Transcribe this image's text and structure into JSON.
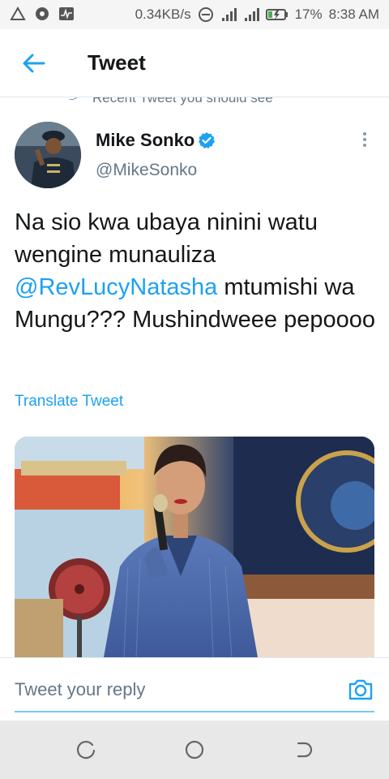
{
  "status_bar": {
    "net_speed": "0.34KB/s",
    "battery": "17%",
    "time": "8:38 AM",
    "icons": [
      "alert-triangle-icon",
      "chrome-icon",
      "pulse-icon",
      "dnd-icon",
      "signal-icon",
      "signal-icon",
      "battery-charging-icon"
    ]
  },
  "app_bar": {
    "title": "Tweet",
    "back_icon": "arrow-left-icon"
  },
  "tweet": {
    "recent_banner": "Recent Tweet you should see",
    "author": {
      "name": "Mike Sonko",
      "handle": "@MikeSonko",
      "verified": true
    },
    "text_before": "Na sio kwa ubaya ninini watu wengine munauliza ",
    "mention": "@RevLucyNatasha",
    "text_after": " mtumishi wa Mungu??? Mushindweee pepoooo",
    "translate_label": "Translate Tweet"
  },
  "reply": {
    "placeholder": "Tweet your reply",
    "camera_icon": "camera-icon"
  },
  "nav": {
    "icons": [
      "recent-apps-icon",
      "home-icon",
      "back-icon"
    ]
  },
  "colors": {
    "accent": "#1da1f2",
    "text_primary": "#14171a",
    "text_secondary": "#657786"
  }
}
